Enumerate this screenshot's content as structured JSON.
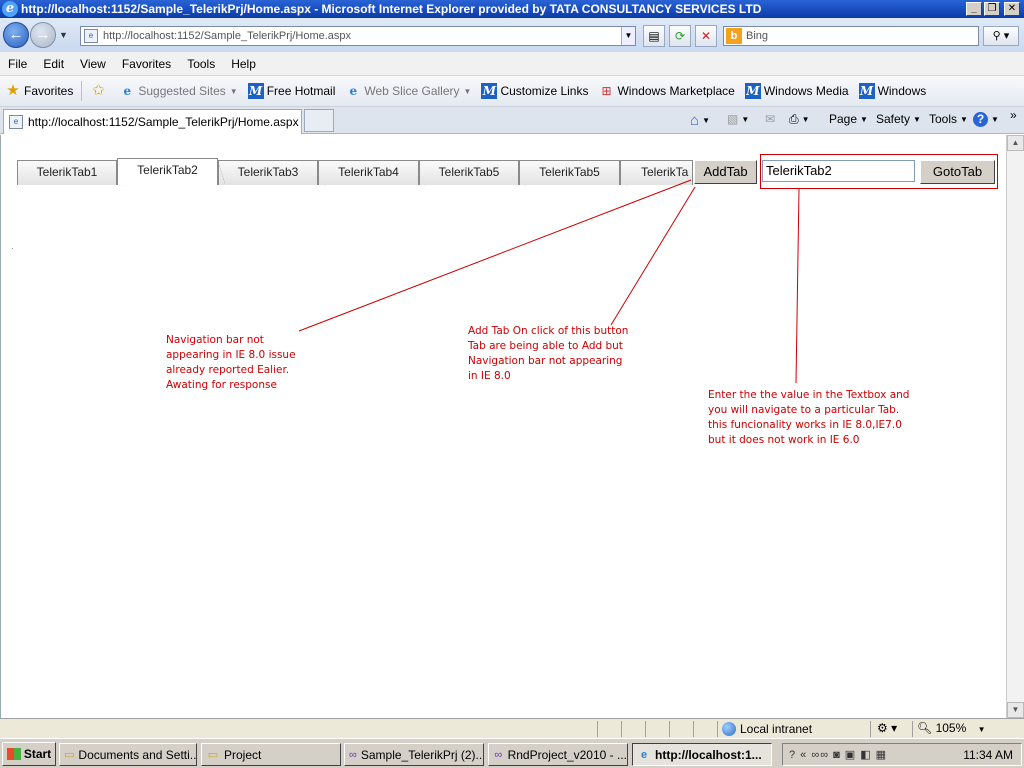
{
  "window": {
    "title": "http://localhost:1152/Sample_TelerikPrj/Home.aspx - Microsoft Internet Explorer provided by TATA CONSULTANCY SERVICES LTD",
    "minimize": "_",
    "maximize": "❐",
    "close": "✕"
  },
  "address_bar": {
    "url": "http://localhost:1152/Sample_TelerikPrj/Home.aspx",
    "search_placeholder": "Bing"
  },
  "menu": [
    "File",
    "Edit",
    "View",
    "Favorites",
    "Tools",
    "Help"
  ],
  "favorites_bar": {
    "favorites_label": "Favorites",
    "items": [
      {
        "label": "Suggested Sites",
        "icon": "ie-icon"
      },
      {
        "label": "Free Hotmail",
        "icon": "msn-icon"
      },
      {
        "label": "Web Slice Gallery",
        "icon": "ie-icon"
      },
      {
        "label": "Customize Links",
        "icon": "msn-icon"
      },
      {
        "label": "Windows Marketplace",
        "icon": "windows-icon"
      },
      {
        "label": "Windows Media",
        "icon": "msn-icon"
      },
      {
        "label": "Windows",
        "icon": "msn-icon"
      }
    ]
  },
  "browser_tab": {
    "label": "http://localhost:1152/Sample_TelerikPrj/Home.aspx"
  },
  "command_bar": {
    "page": "Page",
    "safety": "Safety",
    "tools": "Tools",
    "help": "?"
  },
  "page": {
    "tabs": [
      "TelerikTab1",
      "TelerikTab2",
      "TelerikTab3",
      "TelerikTab4",
      "TelerikTab5",
      "TelerikTab5",
      "TelerikTa"
    ],
    "selected_tab": "TelerikTab2",
    "add_tab_label": "AddTab",
    "goto_input_value": "TelerikTab2",
    "goto_button_label": "GotoTab",
    "dot": "·",
    "notes": {
      "nav_bar": "Navigation bar not\nappearing in IE 8.0 issue\nalready reported Ealier.\nAwating for response",
      "add_tab": "Add Tab On click of this button\nTab are being able to Add but\nNavigation bar not appearing\nin IE 8.0",
      "goto_tab": "Enter the the value in the Textbox and\nyou will navigate to a particular Tab.\nthis funcionality works in IE 8.0,IE7.0\nbut it does not work in IE 6.0"
    },
    "annotation_color": "#cc0000"
  },
  "status_bar": {
    "zone": "Local intranet",
    "zoom": "105%"
  },
  "taskbar": {
    "start": "Start",
    "tasks": [
      "Documents and Setti...",
      "Project",
      "Sample_TelerikPrj (2)...",
      "RndProject_v2010 - ...",
      "http://localhost:1..."
    ],
    "clock": "11:34 AM"
  }
}
